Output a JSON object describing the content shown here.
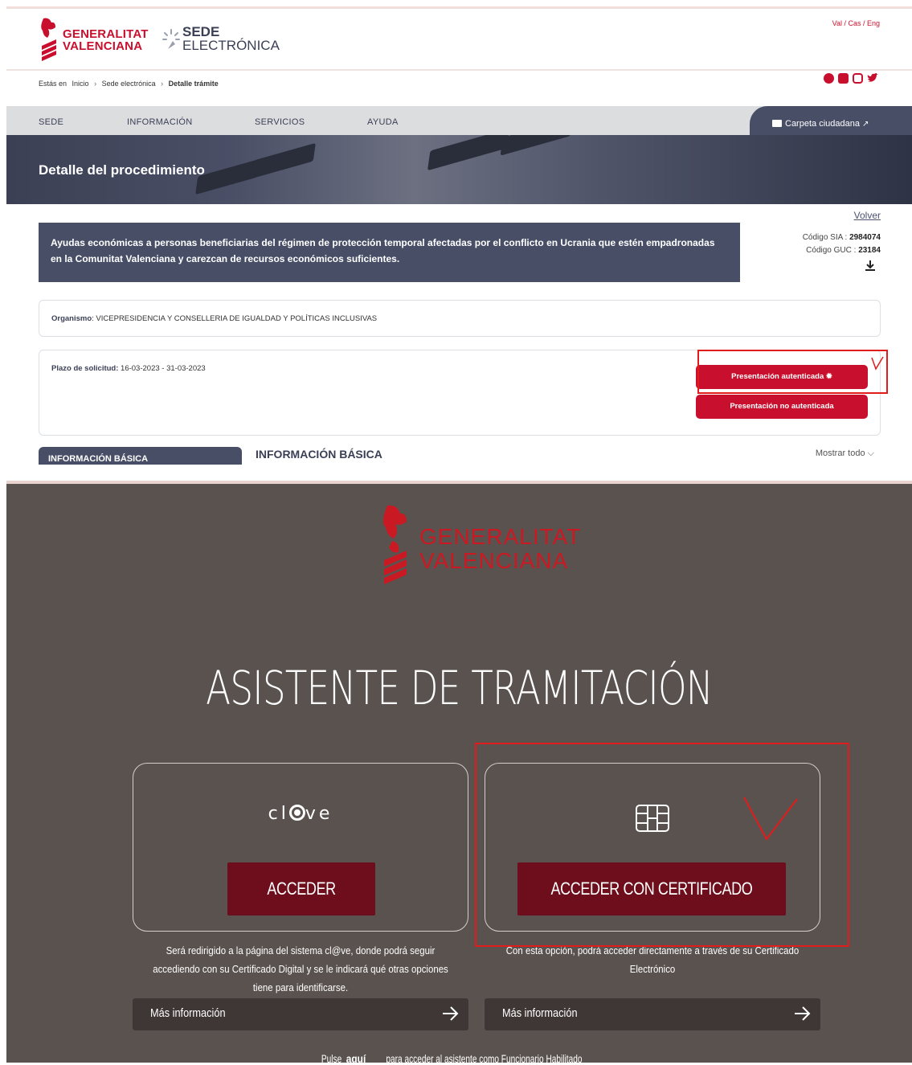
{
  "top": {
    "logo": {
      "gva_line1": "GENERALITAT",
      "gva_line2": "VALENCIANA",
      "sede_line1": "SEDE",
      "sede_line2": "ELECTRÓNICA"
    },
    "lang": "Val / Cas / Eng",
    "breadcrumb": {
      "prefix": "Estás en",
      "items": [
        "Inicio",
        "Sede electrónica",
        "Detalle trámite"
      ]
    },
    "nav": {
      "items": [
        "SEDE",
        "INFORMACIÓN",
        "SERVICIOS",
        "AYUDA"
      ],
      "carpeta": "Carpeta ciudadana"
    },
    "hero_title": "Detalle del procedimiento",
    "volver": "Volver",
    "procedure_title": "Ayudas económicas a personas beneficiarias del régimen de protección temporal afectadas por el conflicto en Ucrania que estén empadronadas en la Comunitat Valenciana y carezcan de recursos económicos suficientes.",
    "codes": {
      "sia_label": "Código SIA :",
      "sia_value": "2984074",
      "guc_label": "Código GUC :",
      "guc_value": "23184"
    },
    "organismo": {
      "label": "Organismo",
      "value": ": VICEPRESIDENCIA Y CONSELLERIA DE IGUALDAD Y POLÍTICAS INCLUSIVAS"
    },
    "plazo": {
      "label": "Plazo de solicitud:",
      "value": "16-03-2023 - 31-03-2023"
    },
    "buttons": {
      "auth": "Presentación autenticada",
      "no_auth": "Presentación no autenticada"
    },
    "tab_label": "INFORMACIÓN BÁSICA",
    "section_title": "INFORMACIÓN BÁSICA",
    "mostrar_todo": "Mostrar todo"
  },
  "bottom": {
    "logo": {
      "line1": "GENERALITAT",
      "line2": "VALENCIANA"
    },
    "title": "ASISTENTE DE TRAMITACIÓN",
    "clave": {
      "logo_left": "cl",
      "logo_right": "ve",
      "button": "ACCEDER",
      "description": "Será redirigido a la página del sistema cl@ve, donde podrá seguir accediendo con su Certificado Digital y se le indicará qué otras opciones tiene para identificarse.",
      "mas_info": "Más información"
    },
    "cert": {
      "button": "ACCEDER CON CERTIFICADO",
      "description": "Con esta opción, podrá acceder directamente a través de su Certificado Electrónico",
      "mas_info": "Más información"
    },
    "footer": {
      "prefix": "Pulse",
      "link": "aquí",
      "suffix": "para acceder al asistente como Funcionario Habilitado"
    }
  },
  "colors": {
    "brand_red": "#c8102e",
    "nav_dark": "#474e66",
    "bottom_bg": "#5a524f",
    "button_dark_red": "#6e0d1b",
    "annotation_red": "#e21b1b"
  }
}
